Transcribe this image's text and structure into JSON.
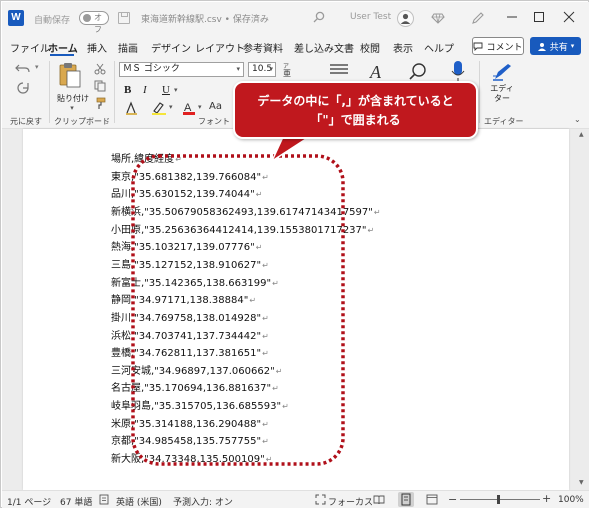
{
  "titlebar": {
    "app_icon": "word-icon",
    "app_letter": "W",
    "autosave_label": "自動保存",
    "autosave_state": "オフ",
    "document_title": "東海道新幹線駅.csv • 保存済み",
    "user_name": "User Test"
  },
  "menu": {
    "tabs": [
      "ファイル",
      "ホーム",
      "挿入",
      "描画",
      "デザイン",
      "レイアウト",
      "参考資料",
      "差し込み文書",
      "校閲",
      "表示",
      "ヘルプ"
    ],
    "active_tab": "ホーム",
    "comment_label": "コメント",
    "share_label": "共有"
  },
  "ribbon": {
    "undo_group_label": "元に戻す",
    "clipboard_group_label": "クリップボード",
    "paste_label": "貼り付け",
    "font_group_label": "フォント",
    "editor_label": "エディター",
    "editor_group_label": "エディター",
    "font_name": "ＭＳ ゴシック",
    "font_size": "10.5",
    "bold": "B",
    "italic": "I",
    "underline": "U",
    "aa": "Aa"
  },
  "document": {
    "lines": [
      "場所,緯度経度",
      "東京,\"35.681382,139.766084\"",
      "品川,\"35.630152,139.74044\"",
      "新横浜,\"35.50679058362493,139.61747143417597\"",
      "小田原,\"35.25636364412414,139.1553801717237\"",
      "熱海,\"35.103217,139.07776\"",
      "三島,\"35.127152,138.910627\"",
      "新富士,\"35.142365,138.663199\"",
      "静岡,\"34.97171,138.38884\"",
      "掛川,\"34.769758,138.014928\"",
      "浜松,\"34.703741,137.734442\"",
      "豊橋,\"34.762811,137.381651\"",
      "三河安城,\"34.96897,137.060662\"",
      "名古屋,\"35.170694,136.881637\"",
      "岐阜羽島,\"35.315705,136.685593\"",
      "米原,\"35.314188,136.290488\"",
      "京都,\"34.985458,135.757755\"",
      "新大阪,\"34.73348,135.500109\""
    ],
    "paragraph_mark": "↵"
  },
  "callout": {
    "line1": "データの中に「,」が含まれていると",
    "line2": "「\"」で囲まれる",
    "color": "#c0181e"
  },
  "statusbar": {
    "page": "1/1 ページ",
    "words": "67 単語",
    "language": "英語 (米国)",
    "predictive": "予測入力: オン",
    "focus": "フォーカス",
    "zoom": "100%"
  },
  "colors": {
    "accent": "#185abd",
    "highlight_red": "#c0181e",
    "background": "#f3f3f3"
  }
}
